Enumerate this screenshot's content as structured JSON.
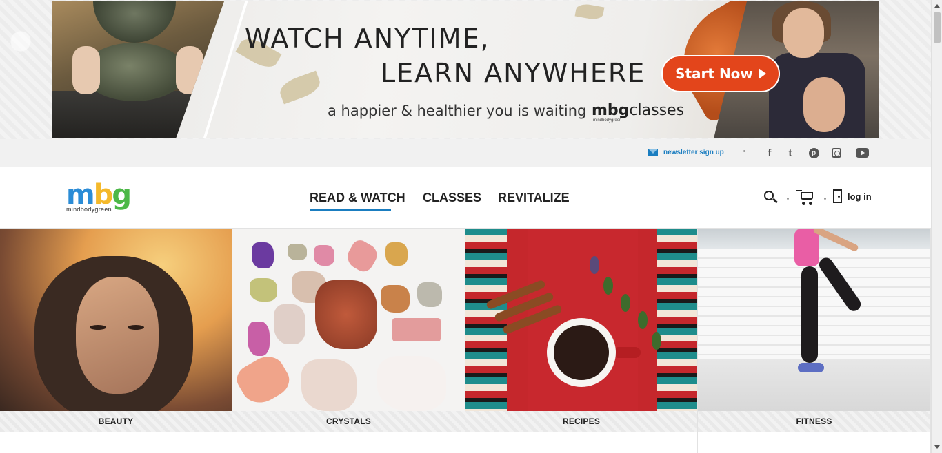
{
  "banner": {
    "headline_line1": "WATCH ANYTIME,",
    "headline_line2": "LEARN ANYWHERE",
    "tagline": "a happier & healthier you is waiting",
    "brand_bold": "mbg",
    "brand_rest": "classes",
    "brand_small": "mindbodygreen",
    "cta_label": "Start Now",
    "cta_color": "#e3451b"
  },
  "utility": {
    "newsletter_label": "newsletter sign up",
    "newsletter_icon": "mail-icon",
    "social": [
      {
        "name": "facebook",
        "glyph": "f"
      },
      {
        "name": "twitter",
        "glyph": "t"
      },
      {
        "name": "pinterest",
        "glyph": "p"
      },
      {
        "name": "instagram",
        "glyph": ""
      },
      {
        "name": "youtube",
        "glyph": ""
      }
    ]
  },
  "nav": {
    "logo": {
      "m": "m",
      "b": "b",
      "g": "g",
      "sub": "mindbodygreen"
    },
    "links": [
      "READ & WATCH",
      "CLASSES",
      "REVITALIZE"
    ],
    "active_link": "READ & WATCH",
    "active_color": "#1a7dc0",
    "login_label": "log in"
  },
  "categories": [
    {
      "label": "BEAUTY"
    },
    {
      "label": "CRYSTALS"
    },
    {
      "label": "RECIPES"
    },
    {
      "label": "FITNESS"
    }
  ]
}
